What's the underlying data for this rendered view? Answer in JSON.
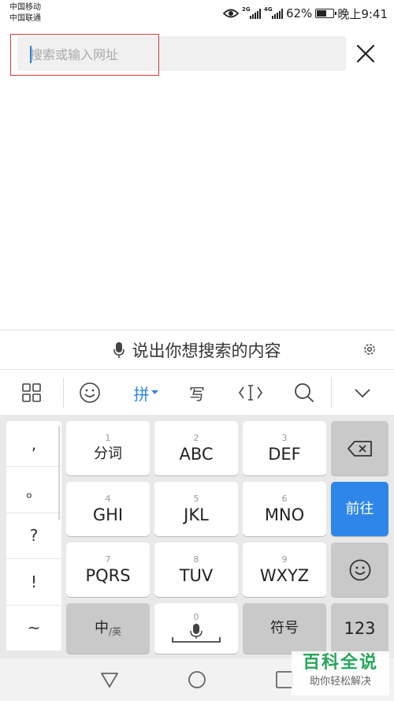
{
  "status": {
    "carrier1": "中国移动",
    "carrier2": "中国联通",
    "sig1_tag": "2G",
    "sig2_tag": "4G",
    "battery": "62%",
    "battery_level": 0.62,
    "time": "晚上9:41"
  },
  "search": {
    "placeholder": "搜索或输入网址",
    "value": ""
  },
  "voice": {
    "label": "说出你想搜索的内容"
  },
  "toolbar": {
    "pinyin": "拼",
    "handwrite": "写"
  },
  "keyboard": {
    "punctuation": [
      ",",
      "。",
      "?",
      "!",
      "~"
    ],
    "keys": [
      {
        "num": "1",
        "label": "分词"
      },
      {
        "num": "2",
        "label": "ABC"
      },
      {
        "num": "3",
        "label": "DEF"
      },
      {
        "num": "4",
        "label": "GHI"
      },
      {
        "num": "5",
        "label": "JKL"
      },
      {
        "num": "6",
        "label": "MNO"
      },
      {
        "num": "7",
        "label": "PQRS"
      },
      {
        "num": "8",
        "label": "TUV"
      },
      {
        "num": "9",
        "label": "WXYZ"
      }
    ],
    "go": "前往",
    "lang_main": "中",
    "lang_sub": "/英",
    "space_num": "0",
    "symbols": "符号",
    "numbers": "123"
  },
  "watermark": {
    "main": "百科全说",
    "sub": "助你轻松解决"
  },
  "colors": {
    "accent": "#2e86e8",
    "highlight": "#d33a3a",
    "watermark": "#26a65b"
  }
}
